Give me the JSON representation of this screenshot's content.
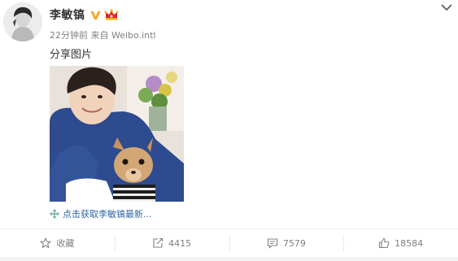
{
  "post": {
    "username": "李敏镐",
    "time": "22分钟前",
    "source_prefix": "来自",
    "source": "Weibo.intl",
    "text": "分享图片",
    "link_text": "点击获取李敏镐最新..."
  },
  "actions": {
    "favorite_label": "收藏",
    "repost_count": "4415",
    "comment_count": "7579",
    "like_count": "18584"
  },
  "icons": {
    "verified": "verified-v-badge",
    "crown": "crown-icon",
    "collapse": "chevron-down-icon",
    "link": "flower-link-icon"
  },
  "colors": {
    "verified": "#f5a623",
    "link": "#2e66a8",
    "meta": "#808080",
    "crown": "#e0262d"
  }
}
